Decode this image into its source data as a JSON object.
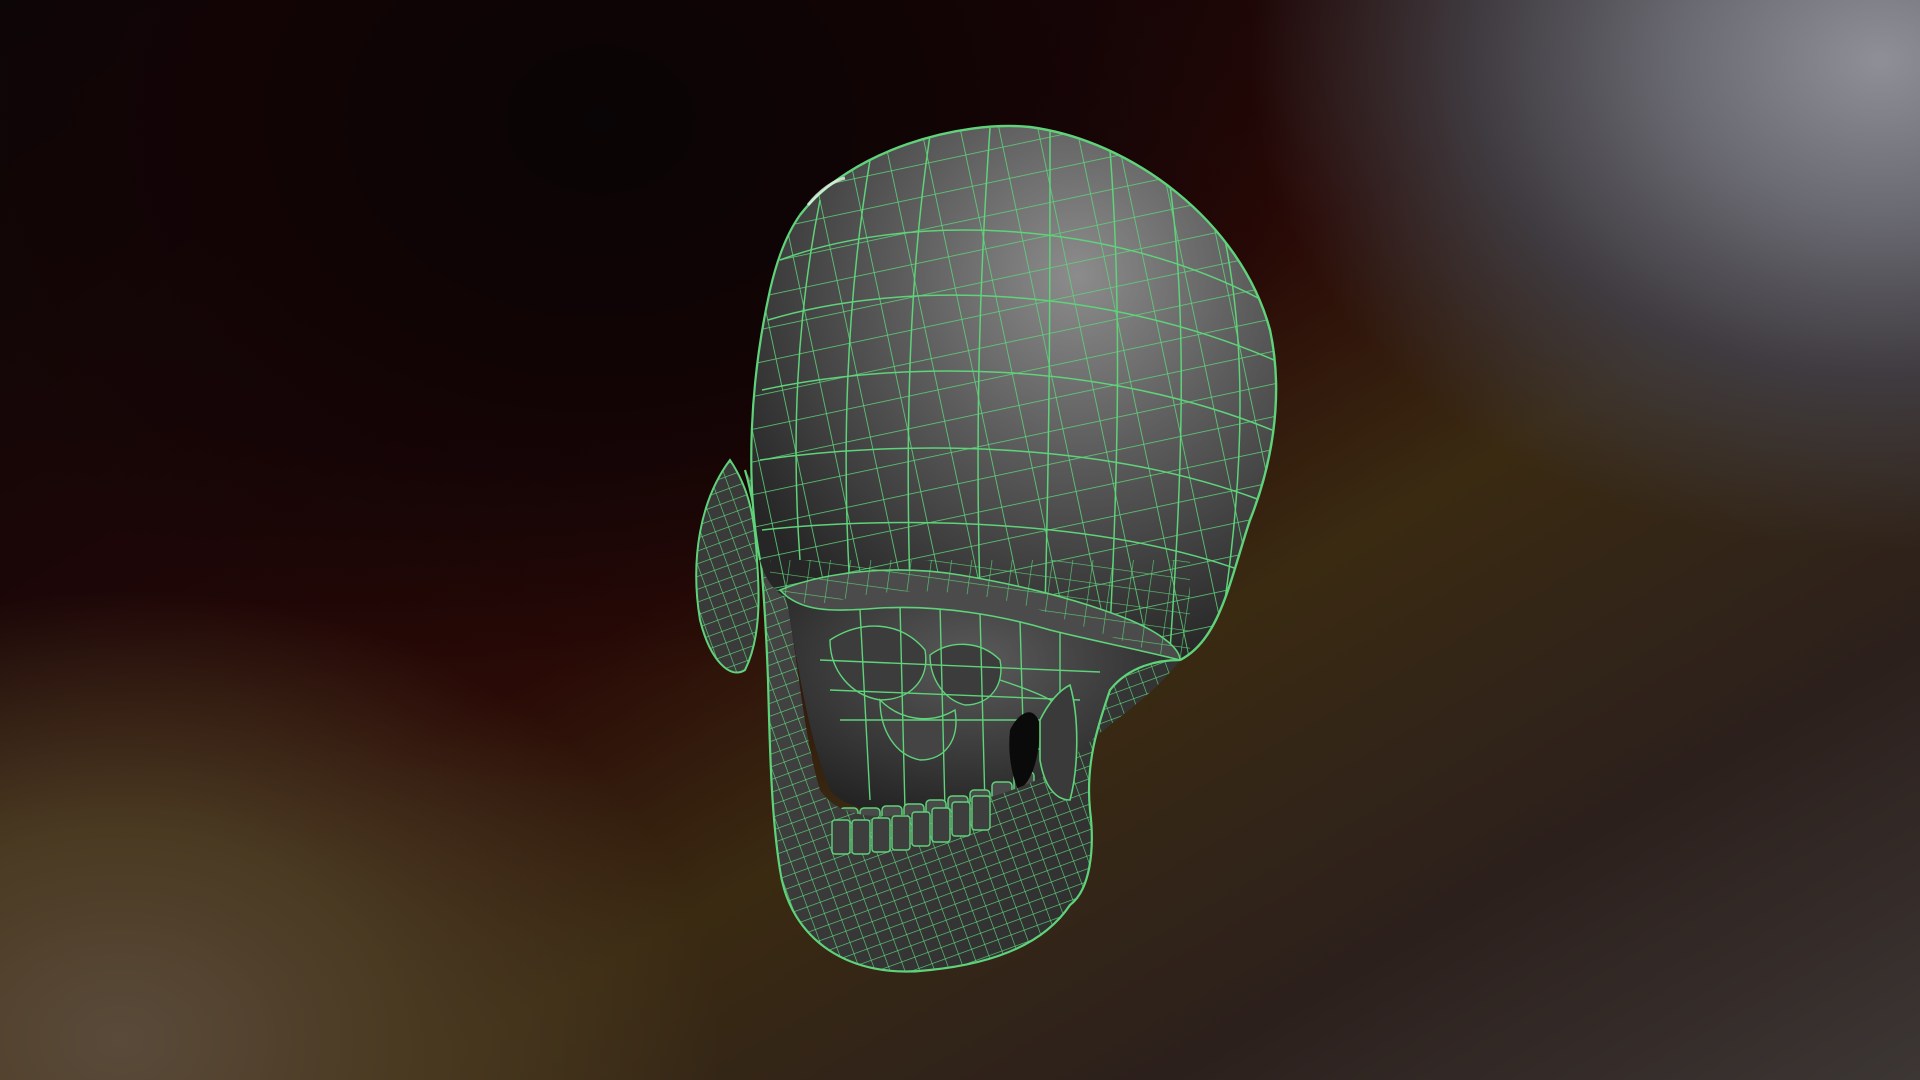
{
  "viewer": {
    "title": "",
    "model": {
      "name": "",
      "display_mode": "wireframe",
      "icon": "skull-icon"
    },
    "colors": {
      "wire": "#5fd37a",
      "shade_light": "#8a8a8a",
      "shade_dark": "#2d2d2d",
      "bg_top_right": "#8f8f98",
      "bg_bottom_left": "#4a3a22",
      "bg_center": "#1d0607"
    }
  }
}
